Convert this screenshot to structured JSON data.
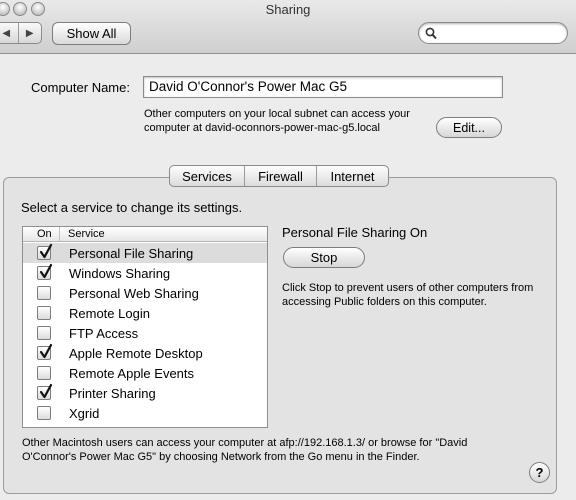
{
  "window": {
    "title": "Sharing"
  },
  "toolbar": {
    "back_glyph": "◀",
    "forward_glyph": "▶",
    "show_all_label": "Show All",
    "search_value": ""
  },
  "computer": {
    "name_label": "Computer Name:",
    "name_value": "David O'Connor's Power Mac G5",
    "info": "Other computers on your local subnet can access your computer at david-oconnors-power-mac-g5.local",
    "edit_label": "Edit..."
  },
  "tabs": [
    {
      "label": "Services",
      "selected": true
    },
    {
      "label": "Firewall",
      "selected": false
    },
    {
      "label": "Internet",
      "selected": false
    }
  ],
  "services": {
    "prompt": "Select a service to change its settings.",
    "col_on": "On",
    "col_service": "Service",
    "items": [
      {
        "label": "Personal File Sharing",
        "checked": true,
        "selected": true
      },
      {
        "label": "Windows Sharing",
        "checked": true,
        "selected": false
      },
      {
        "label": "Personal Web Sharing",
        "checked": false,
        "selected": false
      },
      {
        "label": "Remote Login",
        "checked": false,
        "selected": false
      },
      {
        "label": "FTP Access",
        "checked": false,
        "selected": false
      },
      {
        "label": "Apple Remote Desktop",
        "checked": true,
        "selected": false
      },
      {
        "label": "Remote Apple Events",
        "checked": false,
        "selected": false
      },
      {
        "label": "Printer Sharing",
        "checked": true,
        "selected": false
      },
      {
        "label": "Xgrid",
        "checked": false,
        "selected": false
      }
    ]
  },
  "detail": {
    "status_title": "Personal File Sharing On",
    "stop_label": "Stop",
    "stop_info": "Click Stop to prevent users of other computers from accessing Public folders on this computer."
  },
  "footer": {
    "info": "Other Macintosh users can access your computer at afp://192.168.1.3/ or browse for \"David O'Connor's Power Mac G5\" by choosing Network from the Go menu in the Finder.",
    "help_glyph": "?"
  }
}
